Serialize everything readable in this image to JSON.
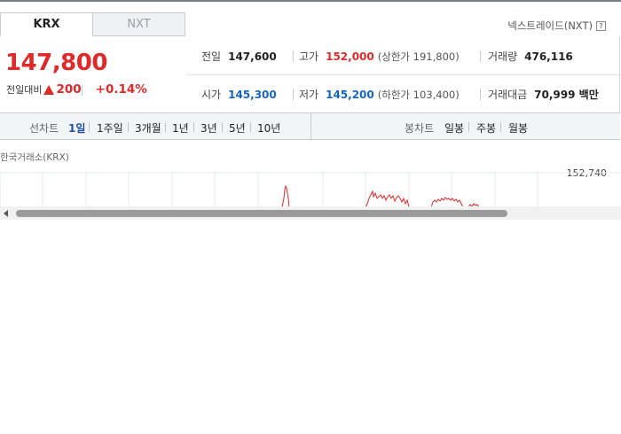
{
  "tabs": {
    "krx": "KRX",
    "nxt": "NXT"
  },
  "nxt_link": {
    "label": "넥스트레이드(NXT)",
    "icon": "?"
  },
  "price": {
    "current": "147,800",
    "change_label": "전일대비",
    "change_amount": "200",
    "change_pct": "+0.14%",
    "direction": "up"
  },
  "stats": {
    "prev_close": {
      "label": "전일",
      "value": "147,600"
    },
    "high": {
      "label": "고가",
      "value": "152,000",
      "limit_label": "(상한가",
      "limit_value": "191,800)"
    },
    "volume": {
      "label": "거래량",
      "value": "476,116"
    },
    "open": {
      "label": "시가",
      "value": "145,300"
    },
    "low": {
      "label": "저가",
      "value": "145,200",
      "limit_label": "(하한가",
      "limit_value": "103,400)"
    },
    "trade_value": {
      "label": "거래대금",
      "value": "70,999 백만"
    }
  },
  "line_chart": {
    "label": "선차트",
    "periods": [
      "1일",
      "1주일",
      "3개월",
      "1년",
      "3년",
      "5년",
      "10년"
    ],
    "active": "1일"
  },
  "candle_chart": {
    "label": "봉차트",
    "periods": [
      "일봉",
      "주봉",
      "월봉"
    ]
  },
  "chart": {
    "exchange_title": "한국거래소(KRX)",
    "y_max_label": "152,740"
  },
  "chart_data": {
    "type": "line",
    "title": "한국거래소(KRX)",
    "ylim_top_label": "152,740",
    "series_color": "#e02a2a"
  },
  "colors": {
    "up": "#e02a2a",
    "down": "#1565c0",
    "active_period": "#1e4ea8"
  }
}
